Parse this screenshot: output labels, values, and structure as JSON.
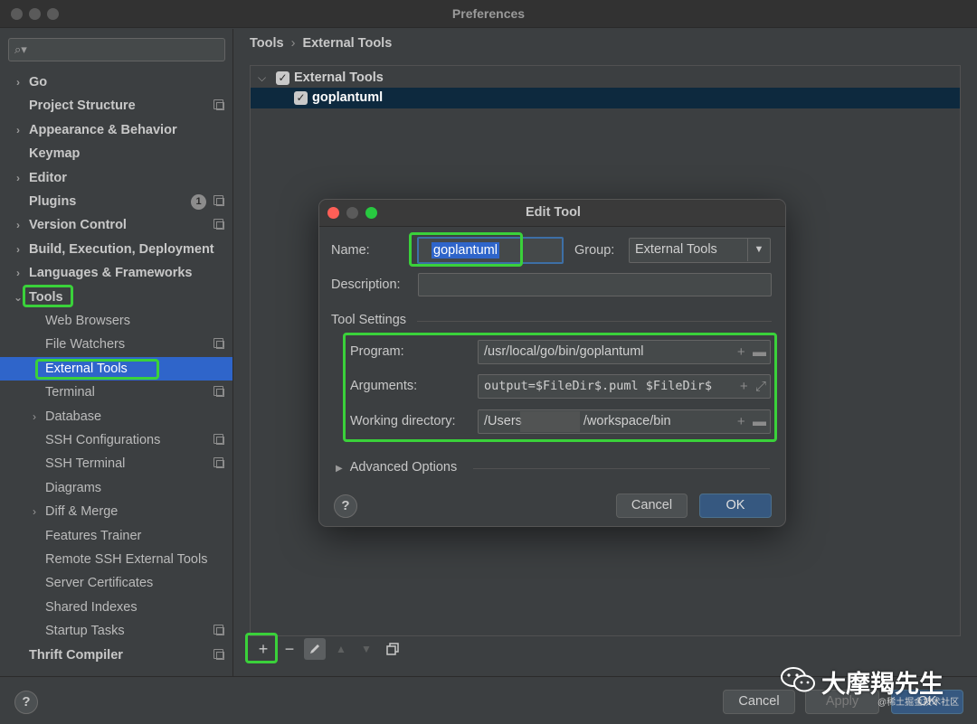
{
  "window": {
    "title": "Preferences"
  },
  "sidebar": {
    "search_placeholder": "",
    "items": [
      {
        "label": "Go"
      },
      {
        "label": "Project Structure"
      },
      {
        "label": "Appearance & Behavior"
      },
      {
        "label": "Keymap"
      },
      {
        "label": "Editor"
      },
      {
        "label": "Plugins",
        "badge": "1"
      },
      {
        "label": "Version Control"
      },
      {
        "label": "Build, Execution, Deployment"
      },
      {
        "label": "Languages & Frameworks"
      },
      {
        "label": "Tools"
      },
      {
        "label": "Web Browsers"
      },
      {
        "label": "File Watchers"
      },
      {
        "label": "External Tools"
      },
      {
        "label": "Terminal"
      },
      {
        "label": "Database"
      },
      {
        "label": "SSH Configurations"
      },
      {
        "label": "SSH Terminal"
      },
      {
        "label": "Diagrams"
      },
      {
        "label": "Diff & Merge"
      },
      {
        "label": "Features Trainer"
      },
      {
        "label": "Remote SSH External Tools"
      },
      {
        "label": "Server Certificates"
      },
      {
        "label": "Shared Indexes"
      },
      {
        "label": "Startup Tasks"
      },
      {
        "label": "Thrift Compiler"
      }
    ]
  },
  "breadcrumb": {
    "parent": "Tools",
    "separator": "›",
    "current": "External Tools"
  },
  "tree": {
    "group_label": "External Tools",
    "tool_label": "goplantuml"
  },
  "toolbar": {
    "add": "+",
    "remove": "−"
  },
  "dialog": {
    "title": "Edit Tool",
    "name_label": "Name:",
    "name_value": "goplantuml",
    "group_label": "Group:",
    "group_value": "External Tools",
    "description_label": "Description:",
    "description_value": "",
    "tool_settings_label": "Tool Settings",
    "program_label": "Program:",
    "program_value": "/usr/local/go/bin/goplantuml",
    "arguments_label": "Arguments:",
    "arguments_value": "output=$FileDir$.puml $FileDir$",
    "workdir_label": "Working directory:",
    "workdir_value_start": "/Users",
    "workdir_value_end": "/workspace/bin",
    "advanced_label": "Advanced Options",
    "help": "?",
    "cancel": "Cancel",
    "ok": "OK"
  },
  "footer": {
    "help": "?",
    "cancel": "Cancel",
    "apply": "Apply",
    "ok": "OK"
  },
  "watermark": {
    "text": "大摩羯先生",
    "small": "@稀土掘金技术社区"
  },
  "colors": {
    "accent_selection": "#2f65ca",
    "highlight_box": "#3ad13a",
    "primary_button": "#365880"
  }
}
